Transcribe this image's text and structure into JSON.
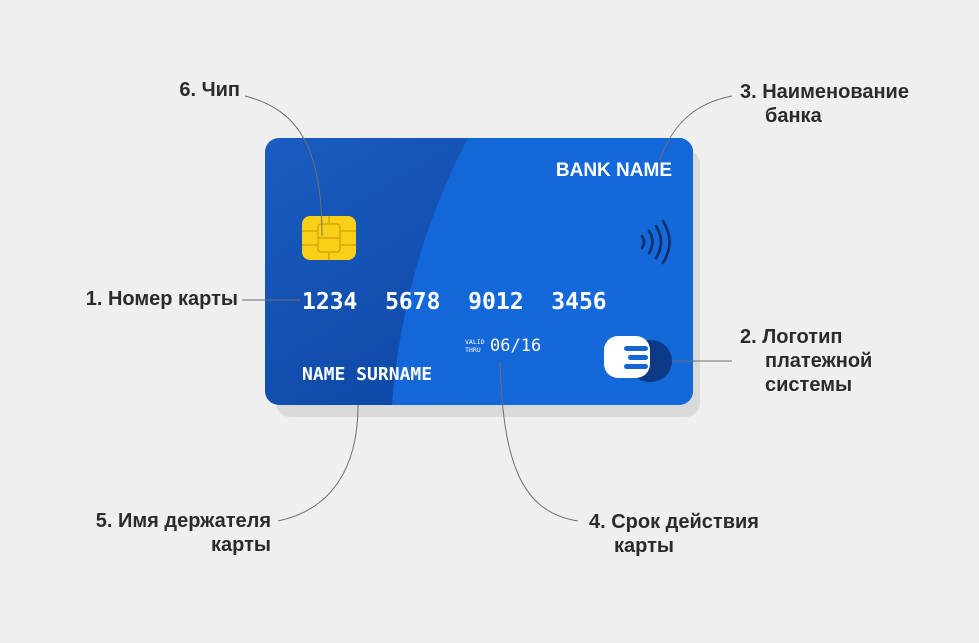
{
  "card": {
    "bank_name": "BANK NAME",
    "number": "1234  5678  9012  3456",
    "valid_line1": "VALID",
    "valid_line2": "THRU",
    "expiry": "06/16",
    "holder_name": "NAME SURNAME"
  },
  "labels": {
    "chip": "6. Чип",
    "card_number": "1. Номер карты",
    "holder_line1": "5. Имя держателя",
    "holder_line2": "карты",
    "bank_line1": "3. Наименование",
    "bank_line2": "банка",
    "logo_line1": "2. Логотип",
    "logo_line2": "платежной",
    "logo_line3": "системы",
    "expiry_line1": "4. Срок действия",
    "expiry_line2": "карты"
  },
  "icons": {
    "chip": "chip-icon",
    "contactless": "contactless-icon",
    "payment_logo": "payment-system-logo-icon"
  },
  "colors": {
    "card_blue": "#1565d2",
    "card_dark": "#0b4aa8",
    "chip_yellow": "#f9cf17",
    "label_text": "#2b2b2b",
    "background": "#efefef"
  }
}
